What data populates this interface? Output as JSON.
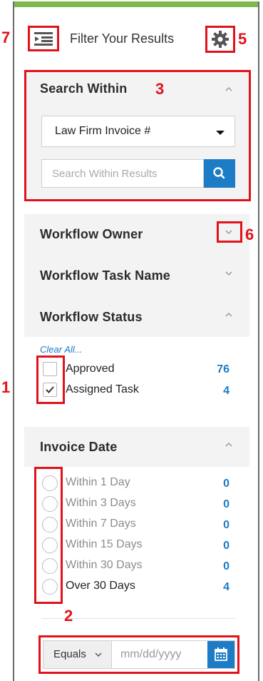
{
  "header": {
    "title": "Filter Your Results"
  },
  "annotations": [
    "1",
    "2",
    "3",
    "5",
    "6",
    "7"
  ],
  "search_within": {
    "title": "Search Within",
    "dropdown_value": "Law Firm Invoice #",
    "search_placeholder": "Search Within Results"
  },
  "sections": {
    "workflow_owner": "Workflow Owner",
    "workflow_task_name": "Workflow Task Name",
    "workflow_status": "Workflow Status",
    "invoice_date": "Invoice Date"
  },
  "workflow_status": {
    "clear_all": "Clear All...",
    "options": [
      {
        "label": "Approved",
        "count": "76",
        "checked": false
      },
      {
        "label": "Assigned Task",
        "count": "4",
        "checked": true
      }
    ]
  },
  "invoice_date": {
    "options": [
      {
        "label": "Within 1 Day",
        "count": "0"
      },
      {
        "label": "Within 3 Days",
        "count": "0"
      },
      {
        "label": "Within 7 Days",
        "count": "0"
      },
      {
        "label": "Within 15 Days",
        "count": "0"
      },
      {
        "label": "Within 30 Days",
        "count": "0"
      },
      {
        "label": "Over 30 Days",
        "count": "4"
      }
    ],
    "operator": "Equals",
    "date_placeholder": "mm/dd/yyyy"
  },
  "colors": {
    "accent": "#1d7cc6",
    "annotation": "#e0131a",
    "top_bar": "#7fb84a"
  },
  "icons": [
    "collapse-panel-icon",
    "gear-icon",
    "search-icon",
    "chevron-up-icon",
    "chevron-down-icon",
    "check-icon",
    "calendar-icon",
    "caret-down-icon"
  ]
}
